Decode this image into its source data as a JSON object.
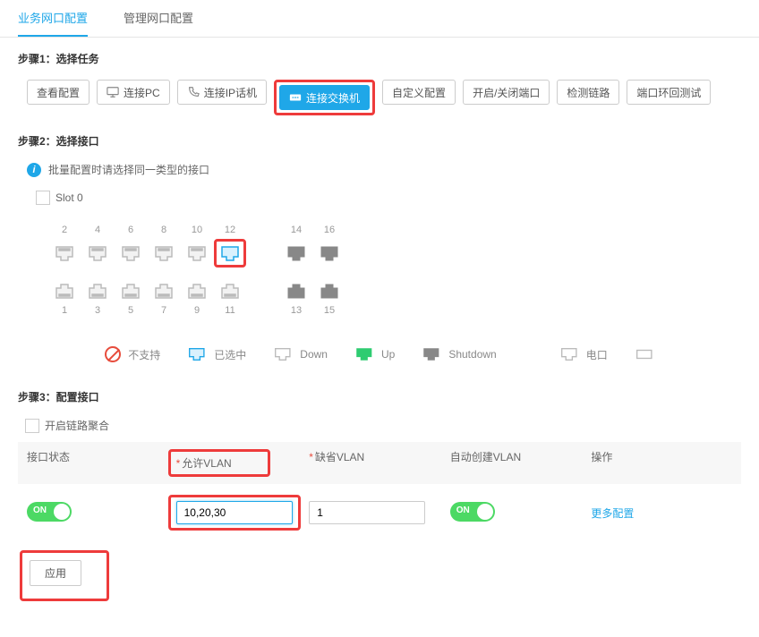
{
  "tabs": {
    "business": "业务网口配置",
    "manage": "管理网口配置"
  },
  "step1": {
    "title": "步骤1：选择任务",
    "buttons": {
      "view_cfg": "查看配置",
      "connect_pc": "连接PC",
      "connect_ipphone": "连接IP话机",
      "connect_switch": "连接交换机",
      "custom_cfg": "自定义配置",
      "toggle_port": "开启/关闭端口",
      "check_link": "检测链路",
      "loop_test": "端口环回测试"
    }
  },
  "step2": {
    "title": "步骤2：选择接口",
    "info": "批量配置时请选择同一类型的接口",
    "slot": "Slot 0",
    "ports_top": [
      "2",
      "4",
      "6",
      "8",
      "10",
      "12",
      "",
      "14",
      "16"
    ],
    "ports_bottom": [
      "1",
      "3",
      "5",
      "7",
      "9",
      "11",
      "",
      "13",
      "15"
    ],
    "selected_ports": [
      "12"
    ],
    "down_ports": [
      "2",
      "4",
      "6",
      "8",
      "10",
      "1",
      "3",
      "5",
      "7",
      "9",
      "11"
    ],
    "legend": {
      "nosupport": "不支持",
      "selected": "已选中",
      "down": "Down",
      "up": "Up",
      "shutdown": "Shutdown",
      "electrical": "电口",
      "optical": ""
    }
  },
  "step3": {
    "title": "步骤3：配置接口",
    "link_agg": "开启链路聚合",
    "headers": {
      "status": "接口状态",
      "allow_vlan": "允许VLAN",
      "default_vlan": "缺省VLAN",
      "auto_vlan": "自动创建VLAN",
      "ops": "操作"
    },
    "values": {
      "status_on": "ON",
      "allow_vlan": "10,20,30",
      "default_vlan": "1",
      "auto_on": "ON",
      "more": "更多配置"
    },
    "apply": "应用"
  }
}
